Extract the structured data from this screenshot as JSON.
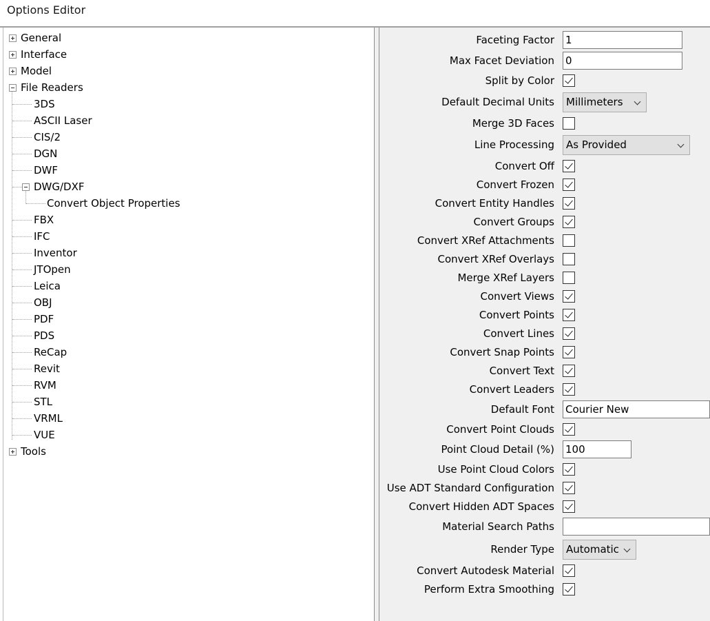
{
  "window": {
    "title": "Options Editor"
  },
  "tree": {
    "general": "General",
    "interface": "Interface",
    "model": "Model",
    "file_readers": "File Readers",
    "readers": {
      "r3ds": "3DS",
      "ascii": "ASCII Laser",
      "cis2": "CIS/2",
      "dgn": "DGN",
      "dwf": "DWF",
      "dwgdxf": "DWG/DXF",
      "convert_object_properties": "Convert Object Properties",
      "fbx": "FBX",
      "ifc": "IFC",
      "inventor": "Inventor",
      "jtopen": "JTOpen",
      "leica": "Leica",
      "obj": "OBJ",
      "pdf": "PDF",
      "pds": "PDS",
      "recap": "ReCap",
      "revit": "Revit",
      "rvm": "RVM",
      "stl": "STL",
      "vrml": "VRML",
      "vue": "VUE"
    },
    "tools": "Tools"
  },
  "props": {
    "faceting_factor": {
      "label": "Faceting Factor",
      "value": "1"
    },
    "max_facet_deviation": {
      "label": "Max Facet Deviation",
      "value": "0"
    },
    "split_by_color": {
      "label": "Split by Color",
      "checked": true
    },
    "default_decimal_units": {
      "label": "Default Decimal Units",
      "value": "Millimeters"
    },
    "merge_3d_faces": {
      "label": "Merge 3D Faces",
      "checked": false
    },
    "line_processing": {
      "label": "Line Processing",
      "value": "As Provided"
    },
    "convert_off": {
      "label": "Convert Off",
      "checked": true
    },
    "convert_frozen": {
      "label": "Convert Frozen",
      "checked": true
    },
    "convert_entity_handles": {
      "label": "Convert Entity Handles",
      "checked": true
    },
    "convert_groups": {
      "label": "Convert Groups",
      "checked": true
    },
    "convert_xref_attachments": {
      "label": "Convert XRef Attachments",
      "checked": false
    },
    "convert_xref_overlays": {
      "label": "Convert XRef Overlays",
      "checked": false
    },
    "merge_xref_layers": {
      "label": "Merge XRef Layers",
      "checked": false
    },
    "convert_views": {
      "label": "Convert Views",
      "checked": true
    },
    "convert_points": {
      "label": "Convert Points",
      "checked": true
    },
    "convert_lines": {
      "label": "Convert Lines",
      "checked": true
    },
    "convert_snap_points": {
      "label": "Convert Snap Points",
      "checked": true
    },
    "convert_text": {
      "label": "Convert Text",
      "checked": true
    },
    "convert_leaders": {
      "label": "Convert Leaders",
      "checked": true
    },
    "default_font": {
      "label": "Default Font",
      "value": "Courier New"
    },
    "convert_point_clouds": {
      "label": "Convert Point Clouds",
      "checked": true
    },
    "point_cloud_detail": {
      "label": "Point Cloud Detail (%)",
      "value": "100"
    },
    "use_point_cloud_colors": {
      "label": "Use Point Cloud Colors",
      "checked": true
    },
    "use_adt_standard_configuration": {
      "label": "Use ADT Standard Configuration",
      "checked": true
    },
    "convert_hidden_adt_spaces": {
      "label": "Convert Hidden ADT Spaces",
      "checked": true
    },
    "material_search_paths": {
      "label": "Material Search Paths",
      "value": ""
    },
    "render_type": {
      "label": "Render Type",
      "value": "Automatic"
    },
    "convert_autodesk_material": {
      "label": "Convert Autodesk Material",
      "checked": true
    },
    "perform_extra_smoothing": {
      "label": "Perform Extra Smoothing",
      "checked": true
    }
  }
}
